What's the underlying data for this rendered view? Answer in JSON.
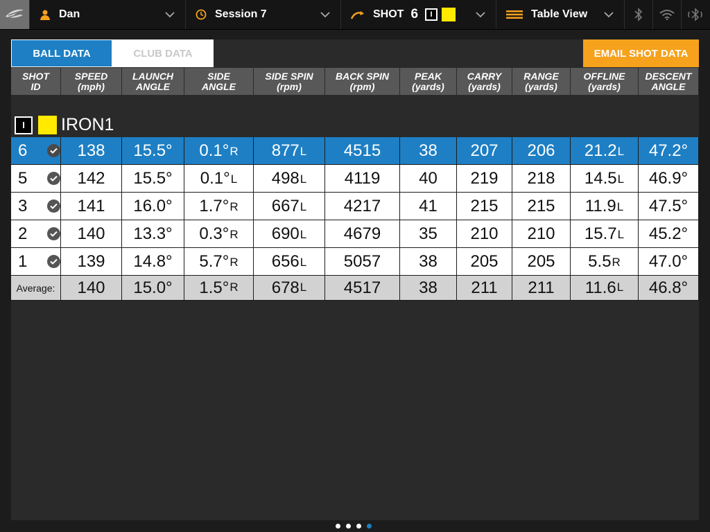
{
  "topbar": {
    "user": "Dan",
    "session": "Session 7",
    "shot_label": "SHOT",
    "shot_number": "6",
    "club_chip": "I",
    "view": "Table View",
    "colors": {
      "accent": "#f6a21d",
      "club_color": "#ffea00"
    }
  },
  "tabs": {
    "ball": "BALL DATA",
    "club": "CLUB DATA"
  },
  "email_button": "EMAIL SHOT DATA",
  "columns": [
    {
      "name": "SHOT",
      "unit": "ID"
    },
    {
      "name": "SPEED",
      "unit": "(mph)"
    },
    {
      "name": "LAUNCH",
      "unit": "ANGLE"
    },
    {
      "name": "SIDE",
      "unit": "ANGLE"
    },
    {
      "name": "SIDE SPIN",
      "unit": "(rpm)"
    },
    {
      "name": "BACK SPIN",
      "unit": "(rpm)"
    },
    {
      "name": "PEAK",
      "unit": "(yards)"
    },
    {
      "name": "CARRY",
      "unit": "(yards)"
    },
    {
      "name": "RANGE",
      "unit": "(yards)"
    },
    {
      "name": "OFFLINE",
      "unit": "(yards)"
    },
    {
      "name": "DESCENT",
      "unit": "ANGLE"
    }
  ],
  "club": {
    "chip": "I",
    "name": "IRON1"
  },
  "shots": [
    {
      "id": "6",
      "speed": "138",
      "launch": "15.5°",
      "side": "0.1°",
      "side_dir": "R",
      "side_spin": "877",
      "side_spin_dir": "L",
      "back_spin": "4515",
      "peak": "38",
      "carry": "207",
      "range": "206",
      "offline": "21.2",
      "offline_dir": "L",
      "descent": "47.2°",
      "selected": true
    },
    {
      "id": "5",
      "speed": "142",
      "launch": "15.5°",
      "side": "0.1°",
      "side_dir": "L",
      "side_spin": "498",
      "side_spin_dir": "L",
      "back_spin": "4119",
      "peak": "40",
      "carry": "219",
      "range": "218",
      "offline": "14.5",
      "offline_dir": "L",
      "descent": "46.9°",
      "selected": false
    },
    {
      "id": "3",
      "speed": "141",
      "launch": "16.0°",
      "side": "1.7°",
      "side_dir": "R",
      "side_spin": "667",
      "side_spin_dir": "L",
      "back_spin": "4217",
      "peak": "41",
      "carry": "215",
      "range": "215",
      "offline": "11.9",
      "offline_dir": "L",
      "descent": "47.5°",
      "selected": false
    },
    {
      "id": "2",
      "speed": "140",
      "launch": "13.3°",
      "side": "0.3°",
      "side_dir": "R",
      "side_spin": "690",
      "side_spin_dir": "L",
      "back_spin": "4679",
      "peak": "35",
      "carry": "210",
      "range": "210",
      "offline": "15.7",
      "offline_dir": "L",
      "descent": "45.2°",
      "selected": false
    },
    {
      "id": "1",
      "speed": "139",
      "launch": "14.8°",
      "side": "5.7°",
      "side_dir": "R",
      "side_spin": "656",
      "side_spin_dir": "L",
      "back_spin": "5057",
      "peak": "38",
      "carry": "205",
      "range": "205",
      "offline": "5.5",
      "offline_dir": "R",
      "descent": "47.0°",
      "selected": false
    }
  ],
  "average": {
    "label": "Average:",
    "speed": "140",
    "launch": "15.0°",
    "side": "1.5°",
    "side_dir": "R",
    "side_spin": "678",
    "side_spin_dir": "L",
    "back_spin": "4517",
    "peak": "38",
    "carry": "211",
    "range": "211",
    "offline": "11.6",
    "offline_dir": "L",
    "descent": "46.8°"
  },
  "pager": {
    "count": 4,
    "active": 4
  }
}
